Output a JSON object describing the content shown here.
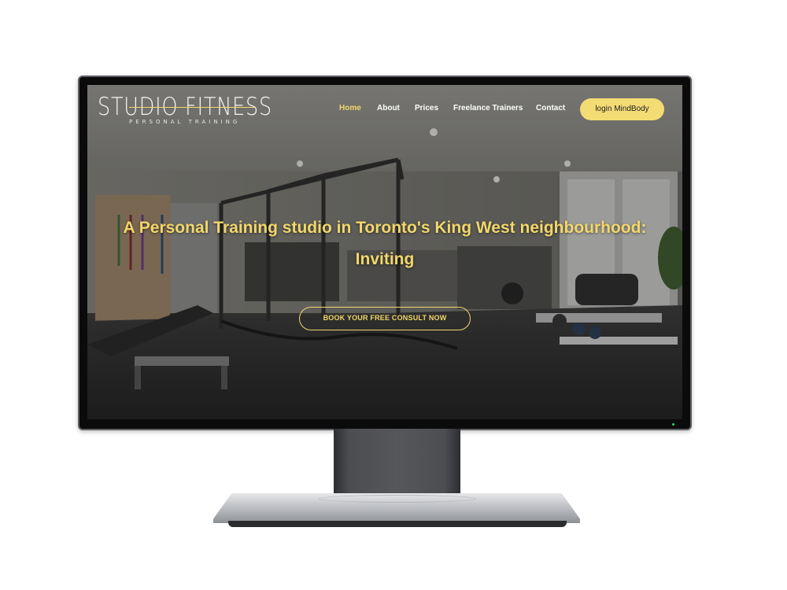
{
  "logo": {
    "main_text": "STUDIO FITNESS",
    "tagline": "PERSONAL TRAINING"
  },
  "nav": {
    "items": [
      {
        "label": "Home",
        "active": true
      },
      {
        "label": "About",
        "active": false
      },
      {
        "label": "Prices",
        "active": false
      },
      {
        "label": "Freelance Trainers",
        "active": false
      },
      {
        "label": "Contact",
        "active": false
      }
    ],
    "login_label": "login MindBody"
  },
  "hero": {
    "title": "A Personal Training studio in Toronto's King West neighbourhood:",
    "subtitle": "Inviting",
    "cta_label": "BOOK YOUR FREE CONSULT NOW"
  },
  "colors": {
    "accent": "#f2d76a",
    "button_fill": "#f4dc74",
    "nav_text": "#ffffff"
  }
}
